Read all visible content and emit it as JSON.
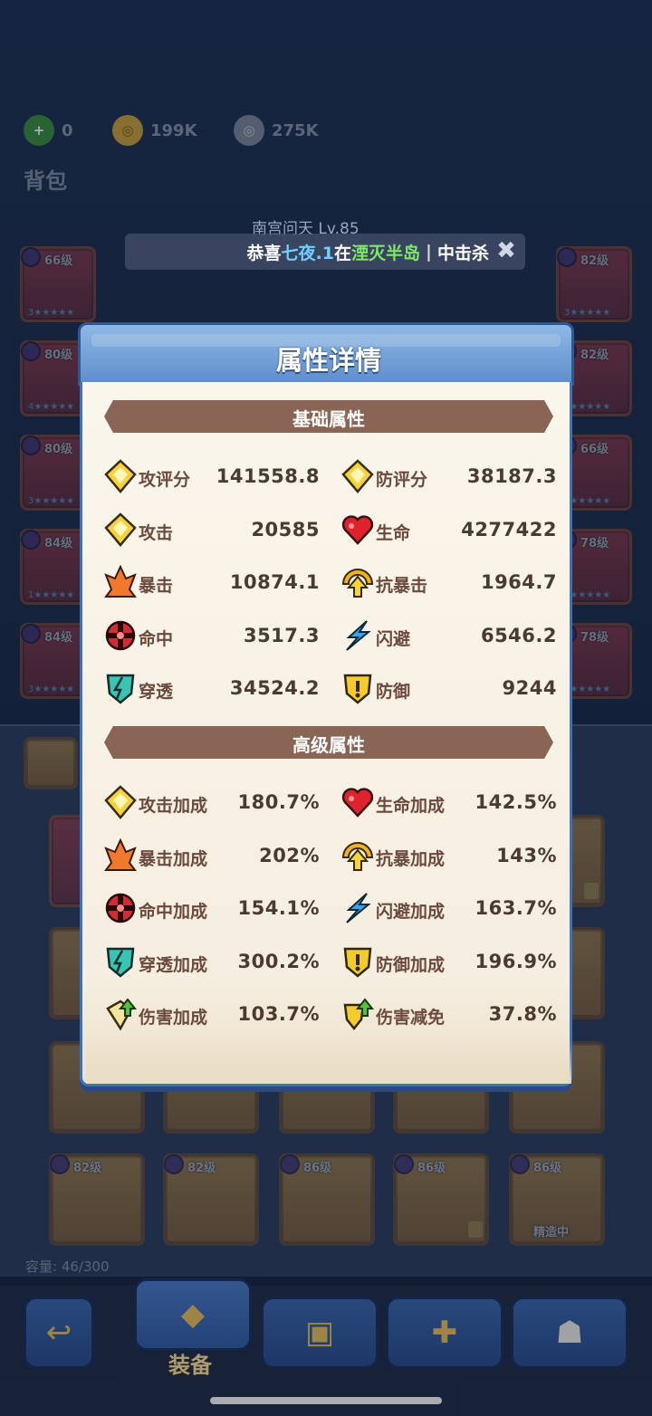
{
  "currencies": [
    {
      "icon": "gem-plus-icon",
      "value": "0",
      "color": "#4caf50"
    },
    {
      "icon": "gold-coin-icon",
      "value": "199K",
      "color": "#c9a23a"
    },
    {
      "icon": "silver-coin-icon",
      "value": "275K",
      "color": "#8891a6"
    }
  ],
  "bag_title": "背包",
  "player_tag": "南宫问天 Lv.85",
  "notice": {
    "prefix": "恭喜",
    "player": "七夜.1",
    "mid": "在",
    "location": "湮灭半岛",
    "separator": "|",
    "suffix": "中击杀"
  },
  "bag_items_left": [
    {
      "level": "66级",
      "stars": "3★★★★★",
      "type": "weapon"
    },
    {
      "level": "80级",
      "stars": "4★★★★★",
      "type": "armor"
    },
    {
      "level": "80级",
      "stars": "3★★★★★",
      "type": "armor"
    },
    {
      "level": "84级",
      "stars": "1★★★★★",
      "type": "ring"
    },
    {
      "level": "84级",
      "stars": "3★★★★★",
      "type": "necklace"
    }
  ],
  "bag_items_right": [
    {
      "level": "82级",
      "stars": "3★★★★★"
    },
    {
      "level": "82级",
      "stars": "3★★★★★"
    },
    {
      "level": "66级",
      "stars": "1★★★★★"
    },
    {
      "level": "78级",
      "stars": "2★★★★★"
    },
    {
      "level": "78级",
      "stars": "5★★★★★"
    }
  ],
  "bottom_items": [
    {
      "level": "82级",
      "style": "gold"
    },
    {
      "level": "82级",
      "style": "gold"
    },
    {
      "level": "86级",
      "style": "gold"
    },
    {
      "level": "86级",
      "style": "gold"
    },
    {
      "level": "86级",
      "style": "gold",
      "status": "精造中"
    }
  ],
  "capacity": "容量: 46/300",
  "nav": {
    "tabs": [
      {
        "icon": "back-arrow-icon"
      },
      {
        "icon": "equipment-icon",
        "label": "装备",
        "active": true
      },
      {
        "icon": "treasure-chest-icon"
      },
      {
        "icon": "puzzle-piece-icon"
      },
      {
        "icon": "demon-mask-icon"
      }
    ]
  },
  "modal": {
    "title": "属性详情",
    "basic_title": "基础属性",
    "basic": [
      {
        "label": "攻评分",
        "value": "141558.8",
        "icon": "attack-score-icon"
      },
      {
        "label": "防评分",
        "value": "38187.3",
        "icon": "defense-score-icon"
      },
      {
        "label": "攻击",
        "value": "20585",
        "icon": "attack-icon"
      },
      {
        "label": "生命",
        "value": "4277422",
        "icon": "heart-icon"
      },
      {
        "label": "暴击",
        "value": "10874.1",
        "icon": "crit-icon"
      },
      {
        "label": "抗暴击",
        "value": "1964.7",
        "icon": "crit-resist-icon"
      },
      {
        "label": "命中",
        "value": "3517.3",
        "icon": "hit-icon"
      },
      {
        "label": "闪避",
        "value": "6546.2",
        "icon": "dodge-icon"
      },
      {
        "label": "穿透",
        "value": "34524.2",
        "icon": "penetration-icon"
      },
      {
        "label": "防御",
        "value": "9244",
        "icon": "shield-icon"
      }
    ],
    "advanced_title": "高级属性",
    "advanced": [
      {
        "label": "攻击加成",
        "value": "180.7%",
        "icon": "attack-icon"
      },
      {
        "label": "生命加成",
        "value": "142.5%",
        "icon": "heart-icon"
      },
      {
        "label": "暴击加成",
        "value": "202%",
        "icon": "crit-icon"
      },
      {
        "label": "抗暴加成",
        "value": "143%",
        "icon": "crit-resist-icon"
      },
      {
        "label": "命中加成",
        "value": "154.1%",
        "icon": "hit-icon"
      },
      {
        "label": "闪避加成",
        "value": "163.7%",
        "icon": "dodge-icon"
      },
      {
        "label": "穿透加成",
        "value": "300.2%",
        "icon": "penetration-icon"
      },
      {
        "label": "防御加成",
        "value": "196.9%",
        "icon": "shield-icon"
      },
      {
        "label": "伤害加成",
        "value": "103.7%",
        "icon": "damage-up-icon"
      },
      {
        "label": "伤害减免",
        "value": "37.8%",
        "icon": "damage-reduce-icon"
      }
    ]
  },
  "colors": {
    "attack": "#f5d33a",
    "heart": "#e0222f",
    "crit": "#f2782b",
    "crit_resist": "#f0b21e",
    "hit": "#d12b35",
    "dodge": "#3aa3ea",
    "penetration": "#3cc3b4",
    "shield": "#f4cb2a"
  }
}
